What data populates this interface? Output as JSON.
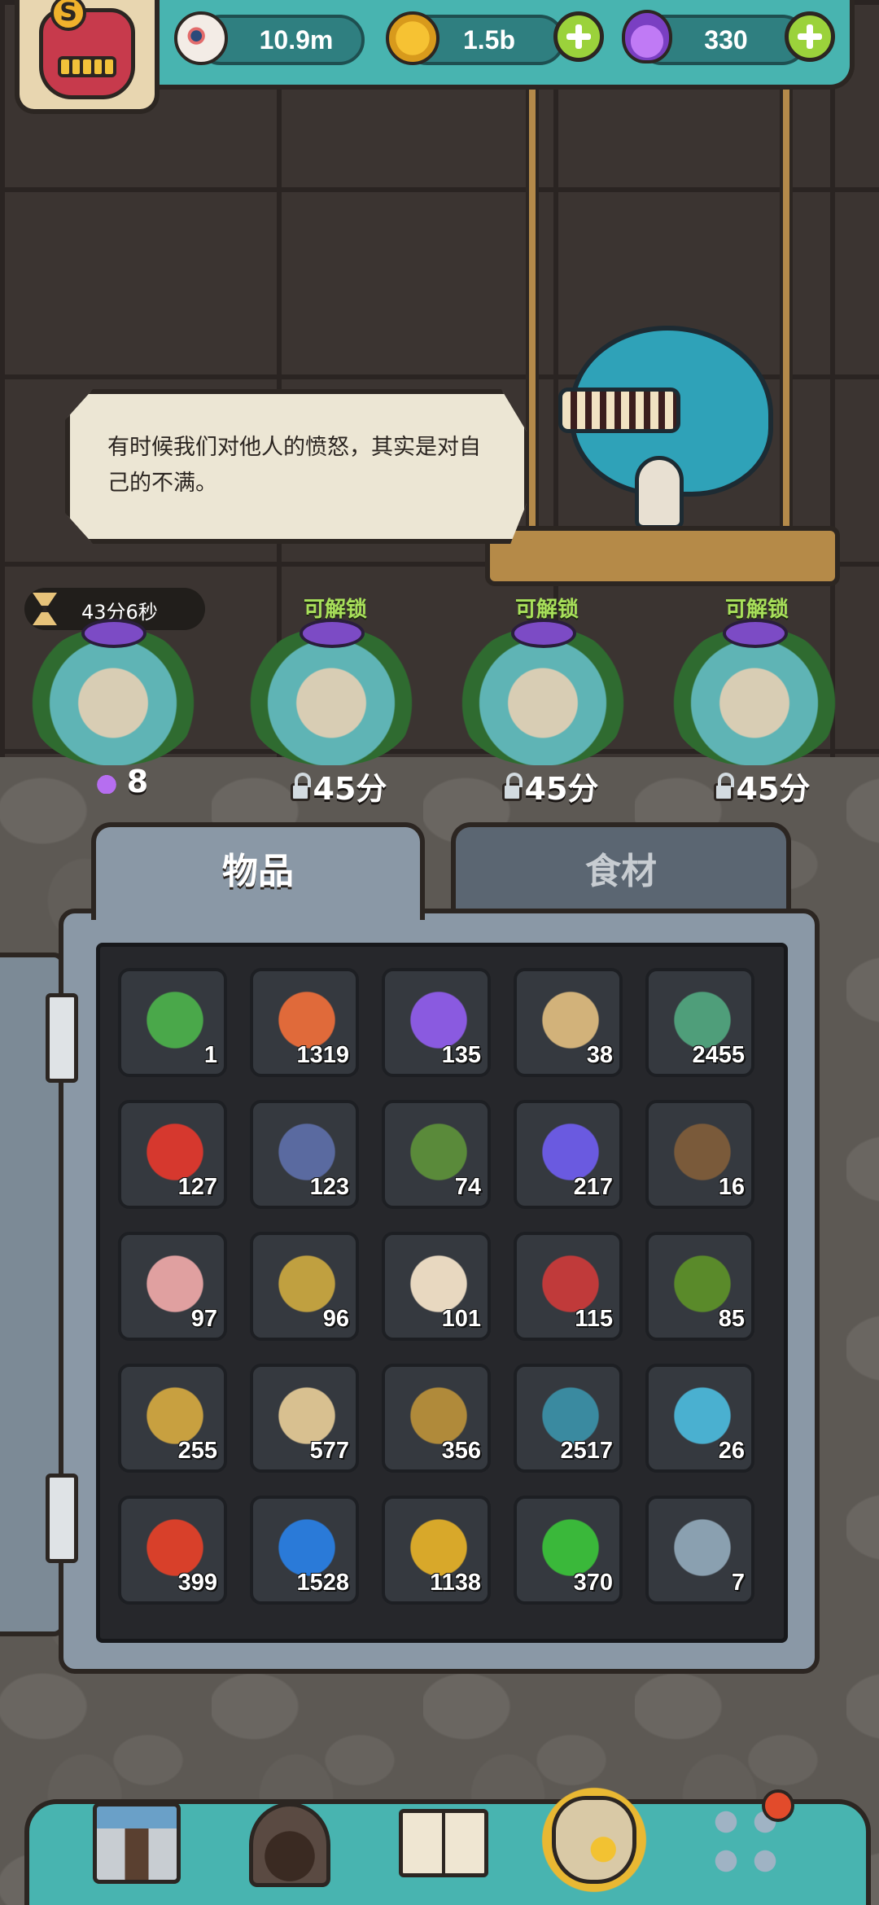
{
  "player": {
    "rank_letter": "S"
  },
  "resources": {
    "eyes": {
      "icon": "eyeball-icon",
      "value": "10.9m"
    },
    "coins": {
      "icon": "gold-coin-icon",
      "value": "1.5b"
    },
    "potions": {
      "icon": "purple-potion-icon",
      "value": "330"
    }
  },
  "npc": {
    "speech": "有时候我们对他人的愤怒，其实是对自己的不满。"
  },
  "eggs": [
    {
      "label": "43分6秒",
      "count": "8",
      "state": "hatching",
      "icon": "potion-icon"
    },
    {
      "label": "可解锁",
      "count": "45分",
      "state": "locked",
      "icon": "lock-icon"
    },
    {
      "label": "可解锁",
      "count": "45分",
      "state": "locked",
      "icon": "lock-icon"
    },
    {
      "label": "可解锁",
      "count": "45分",
      "state": "locked",
      "icon": "lock-icon"
    }
  ],
  "tabs": {
    "items": "物品",
    "ingredients": "食材",
    "active": "items"
  },
  "inventory": [
    {
      "icon": "bottle-icon",
      "count": "1",
      "color": "#4aa84a"
    },
    {
      "icon": "meat-bone-icon",
      "count": "1319",
      "color": "#e06a3a"
    },
    {
      "icon": "purple-sand-icon",
      "count": "135",
      "color": "#8a5ae0"
    },
    {
      "icon": "old-map-icon",
      "count": "38",
      "color": "#d2b27a"
    },
    {
      "icon": "framed-painting-icon",
      "count": "2455",
      "color": "#4f9e7a"
    },
    {
      "icon": "oil-barrel-icon",
      "count": "127",
      "color": "#d6382e"
    },
    {
      "icon": "machine-card-icon",
      "count": "123",
      "color": "#5a6aa0"
    },
    {
      "icon": "poster-card-icon",
      "count": "74",
      "color": "#5a8a3a"
    },
    {
      "icon": "crystal-cluster-icon",
      "count": "217",
      "color": "#6a5ae0"
    },
    {
      "icon": "green-ore-icon",
      "count": "16",
      "color": "#7a5a3a"
    },
    {
      "icon": "scroll-blueprint-icon",
      "count": "97",
      "color": "#e0a0a0"
    },
    {
      "icon": "mech-part-icon",
      "count": "96",
      "color": "#c0a040"
    },
    {
      "icon": "rabbit-cake-icon",
      "count": "101",
      "color": "#e8d8c0"
    },
    {
      "icon": "wizard-hat-icon",
      "count": "115",
      "color": "#c03a3a"
    },
    {
      "icon": "eye-leaf-icon",
      "count": "85",
      "color": "#5a8a2a"
    },
    {
      "icon": "gold-chest-icon",
      "count": "255",
      "color": "#c8a040"
    },
    {
      "icon": "coin-pile-icon",
      "count": "577",
      "color": "#d8c090"
    },
    {
      "icon": "tribal-mask-icon",
      "count": "356",
      "color": "#b08a3a"
    },
    {
      "icon": "monster-coin-icon",
      "count": "2517",
      "color": "#3a8aa0"
    },
    {
      "icon": "blue-puzzle-icon",
      "count": "26",
      "color": "#4ab0d0"
    },
    {
      "icon": "red-triangle-gem-icon",
      "count": "399",
      "color": "#d8402a"
    },
    {
      "icon": "blue-square-gem-icon",
      "count": "1528",
      "color": "#2a7ad8"
    },
    {
      "icon": "yellow-pentagon-gem-icon",
      "count": "1138",
      "color": "#d8a82a"
    },
    {
      "icon": "green-hex-gem-icon",
      "count": "370",
      "color": "#3ab83a"
    },
    {
      "icon": "gear-stack-icon",
      "count": "7",
      "color": "#8aa0b0"
    }
  ],
  "nav": [
    {
      "icon": "shop-icon",
      "active": false
    },
    {
      "icon": "monster-lair-icon",
      "active": false
    },
    {
      "icon": "book-icon",
      "active": false
    },
    {
      "icon": "item-bag-icon",
      "active": true
    },
    {
      "icon": "grid-menu-icon",
      "active": false,
      "badge": true
    }
  ]
}
